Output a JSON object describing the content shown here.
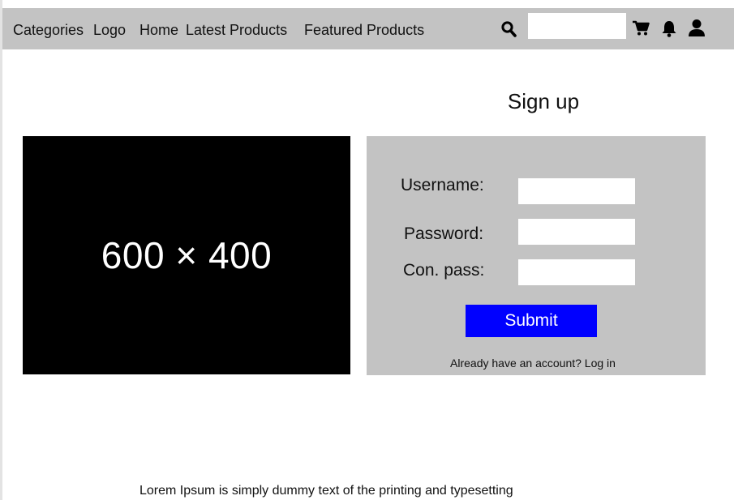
{
  "navbar": {
    "links": [
      "Categories",
      "Logo",
      "Home",
      "Latest Products",
      "Featured Products"
    ],
    "search": {
      "value": "",
      "placeholder": ""
    },
    "icons": [
      "search-icon",
      "cart-icon",
      "bell-icon",
      "user-icon"
    ],
    "background": "#c3c3c3"
  },
  "signup": {
    "title": "Sign up"
  },
  "image_placeholder": {
    "text": "600 × 400",
    "background": "#000000"
  },
  "form": {
    "username_label": "Username:",
    "password_label": "Password:",
    "confirm_label": "Con. pass:",
    "username_value": "",
    "password_value": "",
    "confirm_value": "",
    "submit_label": "Submit",
    "submit_color": "#0000ff",
    "login_text": "Already have an account? Log in"
  },
  "footer": {
    "text": "Lorem Ipsum is simply dummy text of the printing and typesetting"
  }
}
